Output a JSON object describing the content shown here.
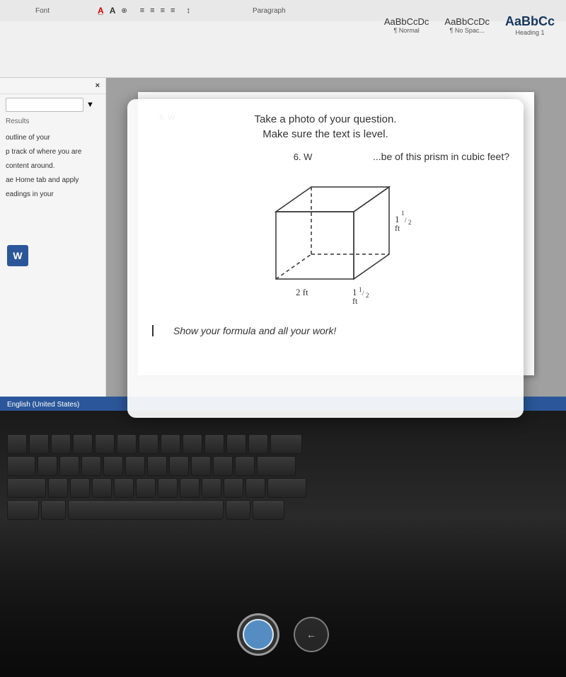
{
  "app": {
    "name": "Microsoft Word",
    "status_language": "English (United States)"
  },
  "toolbar": {
    "font_label": "Font",
    "paragraph_label": "Paragraph",
    "heading_label": "Heading",
    "styles": [
      {
        "sample": "AaBbCcDc",
        "label": "¶ Normal"
      },
      {
        "sample": "AaBbCcDc",
        "label": "¶ No Spac..."
      },
      {
        "sample": "AaBbCc",
        "label": "Heading 1"
      }
    ]
  },
  "sidebar": {
    "close_label": "×",
    "results_label": "Results",
    "nav_items": [
      "outline of your",
      "p track of where you are",
      "content around.",
      "ae Home tab and apply",
      "eadings in your"
    ],
    "bottom_label": "English (United States)"
  },
  "camera_overlay": {
    "message_line1": "Take a photo of your question.",
    "message_line2": "Make sure the text is level.",
    "question_partial": "...be of this prism in cubic feet?",
    "cube_dimensions": {
      "width": "2 ft",
      "height": "1½ ft",
      "depth": "1½ ft"
    },
    "formula_text": "Show your formula and all your work!"
  },
  "doc_page": {
    "question_number": "6. W",
    "question_partial": "...be of this prism in cubic feet?"
  },
  "bottom_buttons": {
    "capture_label": "",
    "back_label": "←"
  }
}
